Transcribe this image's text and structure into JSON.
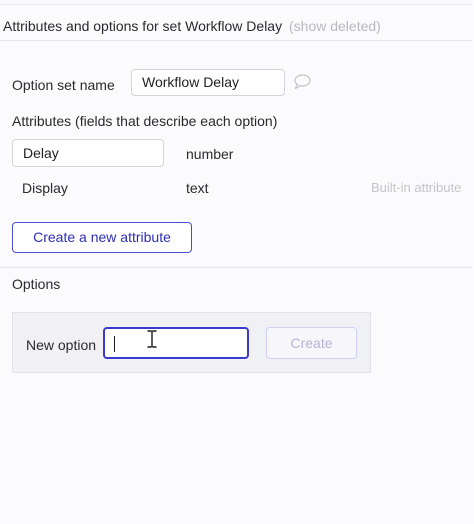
{
  "header": {
    "title": "Attributes and options for set Workflow Delay",
    "show_deleted": "(show deleted)"
  },
  "option_set": {
    "name_label": "Option set name",
    "name_value": "Workflow Delay"
  },
  "attributes": {
    "heading": "Attributes (fields that describe each option)",
    "rows": [
      {
        "name": "Delay",
        "type": "number",
        "note": ""
      },
      {
        "name": "Display",
        "type": "text",
        "note": "Built-in attribute"
      }
    ],
    "create_button": "Create a new attribute"
  },
  "options": {
    "heading": "Options",
    "new_option_label": "New option",
    "new_option_value": "",
    "create_button": "Create"
  },
  "colors": {
    "accent": "#3b3bcf",
    "muted": "#c4c4ca"
  },
  "icons": {
    "comment": "comment-icon",
    "text_cursor": "text-cursor-icon"
  }
}
